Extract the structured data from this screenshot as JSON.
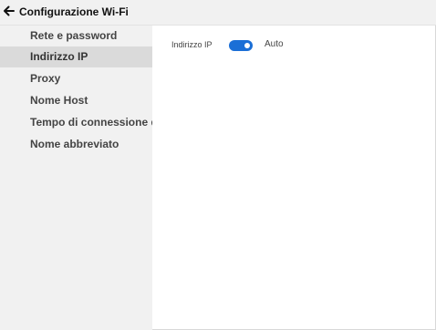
{
  "header": {
    "back_icon": "arrow-left-icon",
    "title": "Configurazione Wi-Fi"
  },
  "sidebar": {
    "items": [
      {
        "label": "Rete e password",
        "selected": false
      },
      {
        "label": "Indirizzo IP",
        "selected": true
      },
      {
        "label": "Proxy",
        "selected": false
      },
      {
        "label": "Nome Host",
        "selected": false
      },
      {
        "label": "Tempo di connessione dir",
        "selected": false
      },
      {
        "label": "Nome abbreviato",
        "selected": false
      }
    ]
  },
  "main": {
    "ip_field": {
      "label": "Indirizzo IP",
      "toggle_on": true,
      "toggle_label": "Auto"
    }
  },
  "colors": {
    "accent": "#1b6fd6",
    "sidebar_bg": "#f1f1f1",
    "selected_bg": "#dadada"
  }
}
